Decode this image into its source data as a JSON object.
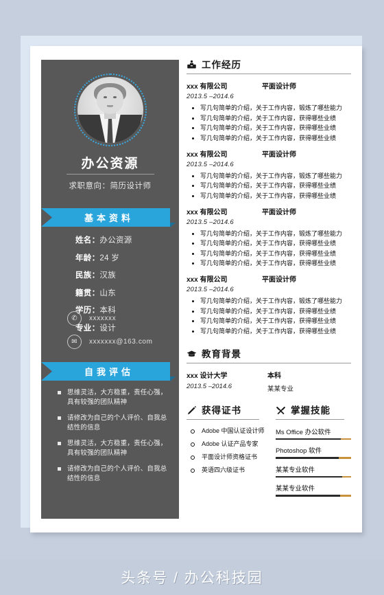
{
  "page": {
    "background_color": "#c5cfdd",
    "paper_color": "#ffffff",
    "sidebar_color": "#585858",
    "accent_color": "#29a5dc",
    "skill_track_color": "#c8923c"
  },
  "sidebar": {
    "photo_alt": "portrait-photo",
    "name": "办公资源",
    "objective": "求职意向：简历设计师",
    "basic_banner": "基本资料",
    "info": [
      {
        "label": "姓名",
        "value": "办公资源"
      },
      {
        "label": "年龄",
        "value": "24 岁"
      },
      {
        "label": "民族",
        "value": "汉族"
      },
      {
        "label": "籍贯",
        "value": "山东"
      },
      {
        "label": "学历",
        "value": "本科"
      },
      {
        "label": "专业",
        "value": "设计"
      }
    ],
    "contacts": [
      {
        "icon": "phone-icon",
        "glyph": "✆",
        "value": "xxxxxxx"
      },
      {
        "icon": "email-icon",
        "glyph": "✉",
        "value": "xxxxxxx@163.com"
      }
    ],
    "self_banner": "自我评估",
    "self_items": [
      "思维灵活，大方稳重，责任心强，具有较强的团队精神",
      "请修改为自己的个人评价、自我总结性的信息",
      "思维灵活，大方稳重，责任心强，具有较强的团队精神",
      "请修改为自己的个人评价、自我总结性的信息"
    ]
  },
  "sections": {
    "work": {
      "title": "工作经历",
      "icon": "briefcase-icon",
      "jobs": [
        {
          "org": "xxx 有限公司",
          "role": "平面设计师",
          "date": "2013.5 –2014.6",
          "points": [
            "写几句简单的介绍，关于工作内容，锻炼了哪些能力",
            "写几句简单的介绍，关于工作内容，获得哪些业绩",
            "写几句简单的介绍，关于工作内容，获得哪些业绩",
            "写几句简单的介绍，关于工作内容，获得哪些业绩"
          ]
        },
        {
          "org": "xxx 有限公司",
          "role": "平面设计师",
          "date": "2013.5 –2014.6",
          "points": [
            "写几句简单的介绍，关于工作内容，锻炼了哪些能力",
            "写几句简单的介绍，关于工作内容，获得哪些业绩",
            "写几句简单的介绍，关于工作内容，获得哪些业绩"
          ]
        },
        {
          "org": "xxx 有限公司",
          "role": "平面设计师",
          "date": "2013.5 –2014.6",
          "points": [
            "写几句简单的介绍，关于工作内容，锻炼了哪些能力",
            "写几句简单的介绍，关于工作内容，获得哪些业绩",
            "写几句简单的介绍，关于工作内容，获得哪些业绩",
            "写几句简单的介绍，关于工作内容，获得哪些业绩"
          ]
        },
        {
          "org": "xxx 有限公司",
          "role": "平面设计师",
          "date": "2013.5 –2014.6",
          "points": [
            "写几句简单的介绍，关于工作内容，锻炼了哪些能力",
            "写几句简单的介绍，关于工作内容，获得哪些业绩",
            "写几句简单的介绍，关于工作内容，获得哪些业绩",
            "写几句简单的介绍，关于工作内容，获得哪些业绩"
          ]
        }
      ]
    },
    "education": {
      "title": "教育背景",
      "icon": "graduation-cap-icon",
      "school": "xxx 设计大学",
      "date": "2013.5 –2014.6",
      "degree": "本科",
      "major": "某某专业"
    },
    "certificates": {
      "title": "获得证书",
      "icon": "pen-icon",
      "items": [
        "Adobe 中国认证设计师",
        "Adobe 认证产品专家",
        "平面设计师资格证书",
        "英语四六级证书"
      ]
    },
    "skills": {
      "title": "掌握技能",
      "icon": "tools-icon",
      "items": [
        {
          "name": "Ms Office 办公软件",
          "level": 86
        },
        {
          "name": "Photoshop 软件",
          "level": 84
        },
        {
          "name": "某某专业软件",
          "level": 88
        },
        {
          "name": "某某专业软件",
          "level": 85
        }
      ]
    }
  },
  "footer": {
    "watermark": "头条号 / 办公科技园"
  }
}
